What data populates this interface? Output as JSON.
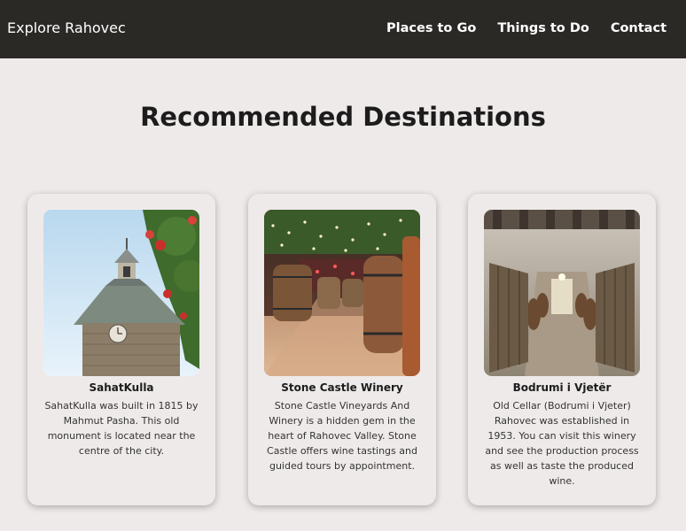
{
  "header": {
    "brand": "Explore Rahovec",
    "nav": [
      {
        "label": "Places to Go"
      },
      {
        "label": "Things to Do"
      },
      {
        "label": "Contact"
      }
    ]
  },
  "main": {
    "title": "Recommended Destinations",
    "cards": [
      {
        "title": "SahatKulla",
        "text": "SahatKulla was built in 1815 by Mahmut Pasha. This old monument is located near the centre of the city."
      },
      {
        "title": "Stone Castle Winery",
        "text": "Stone Castle Vineyards And Winery is a hidden gem in the heart of Rahovec Valley. Stone Castle offers wine tastings and guided tours by appointment."
      },
      {
        "title": "Bodrumi i Vjetër",
        "text": "Old Cellar (Bodrumi i Vjeter) Rahovec was established in 1953. You can visit this winery and see the production process as well as taste the produced wine."
      }
    ]
  },
  "colors": {
    "header_bg": "#2b2926",
    "page_bg": "#efeaea",
    "text": "#1c1c1c"
  }
}
